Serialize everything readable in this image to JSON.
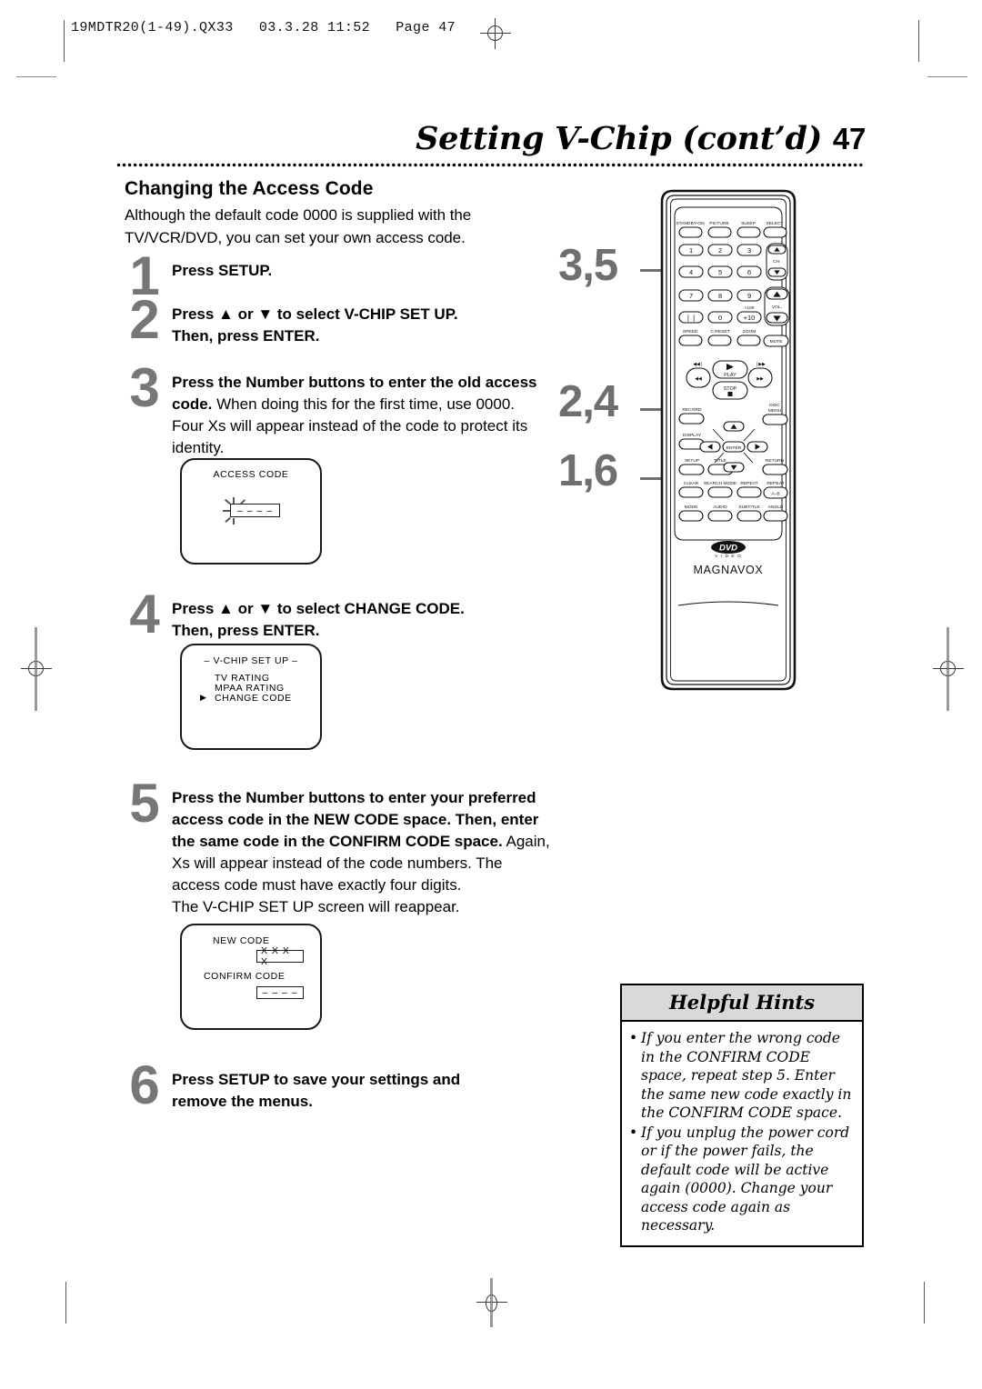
{
  "print_header": "19MDTR20(1-49).QX33   03.3.28 11:52   Page 47",
  "page": {
    "title": "Setting V-Chip (cont’d)",
    "number": "47",
    "section_heading": "Changing the Access Code",
    "intro": "Although the default code 0000 is supplied with the TV/VCR/DVD, you can set your own access code."
  },
  "steps": [
    {
      "n": "1",
      "html": "<b>Press SETUP.</b>"
    },
    {
      "n": "2",
      "html": "<b>Press ▲ or ▼ to select V-CHIP SET UP.<br>Then, press ENTER.</b>"
    },
    {
      "n": "3",
      "html": "<b>Press the Number buttons to enter the old access code.</b> When doing this for the first time, use 0000. Four Xs will appear instead of the code to protect its identity."
    },
    {
      "n": "4",
      "html": "<b>Press ▲ or ▼ to select CHANGE CODE.<br>Then, press ENTER.</b>"
    },
    {
      "n": "5",
      "html": "<b>Press the Number buttons to enter your preferred access code in the NEW CODE space. Then, enter the same code in the CONFIRM CODE space.</b> Again, Xs will appear instead of the code numbers. The access code must have exactly four digits.<br>The V-CHIP SET UP screen will reappear."
    },
    {
      "n": "6",
      "html": "<b>Press SETUP to save your settings and remove the menus.</b>"
    }
  ],
  "screens": {
    "access_code": {
      "title": "ACCESS CODE",
      "field_value": "– – – –"
    },
    "vchip_setup": {
      "title": "– V-CHIP SET UP –",
      "items": [
        "TV RATING",
        "MPAA RATING",
        "CHANGE CODE"
      ],
      "selected_index": 2,
      "cursor": "▶"
    },
    "new_code": {
      "new_label": "NEW CODE",
      "new_value": "X X X X",
      "confirm_label": "CONFIRM CODE",
      "confirm_value": "– – – –"
    }
  },
  "callouts": [
    {
      "label": "3,5"
    },
    {
      "label": "2,4"
    },
    {
      "label": "1,6"
    }
  ],
  "hints": {
    "title": "Helpful Hints",
    "bullet": "•",
    "items": [
      "If you enter the wrong code in the CONFIRM CODE space, repeat step 5. Enter the same new code exactly in the CONFIRM CODE space.",
      "If you unplug the power cord or if the power fails, the default code will be active again (0000). Change your access code again as necessary."
    ]
  },
  "remote": {
    "brand": "MAGNAVOX",
    "logo": "DVD",
    "logo_sub": "V I D E O",
    "row_top": [
      "STANDBY-ON",
      "PICTURE",
      "SLEEP",
      "SELECT"
    ],
    "numbers": [
      "1",
      "2",
      "3",
      "4",
      "5",
      "6",
      "7",
      "8",
      "9",
      "0"
    ],
    "pause": "❘❘",
    "plus_ten": "+10",
    "plus_hundred": "+100",
    "ch_label": "CH.",
    "vol_label": "VOL.",
    "row_speed": [
      "SPEED",
      "C.RESET",
      "ZOOM"
    ],
    "mute": "MUTE",
    "transport": {
      "prev": "◀◀❘",
      "next": "❘▶▶",
      "rew": "◀◀",
      "ff": "▶▶",
      "play": "PLAY",
      "stop": "STOP"
    },
    "record": "RECORD",
    "display": "DISPLAY",
    "setup": "SETUP",
    "title_btn": "TITLE",
    "disc_menu": [
      "DISC",
      "MENU"
    ],
    "return_btn": "RETURN",
    "enter": "ENTER",
    "row_clear": [
      "CLEAR",
      "SEARCH MODE",
      "REPEAT",
      "REPEAT"
    ],
    "repeat_ab": "A–B",
    "row_mode": [
      "MODE",
      "AUDIO",
      "SUBTITLE",
      "ANGLE"
    ]
  }
}
